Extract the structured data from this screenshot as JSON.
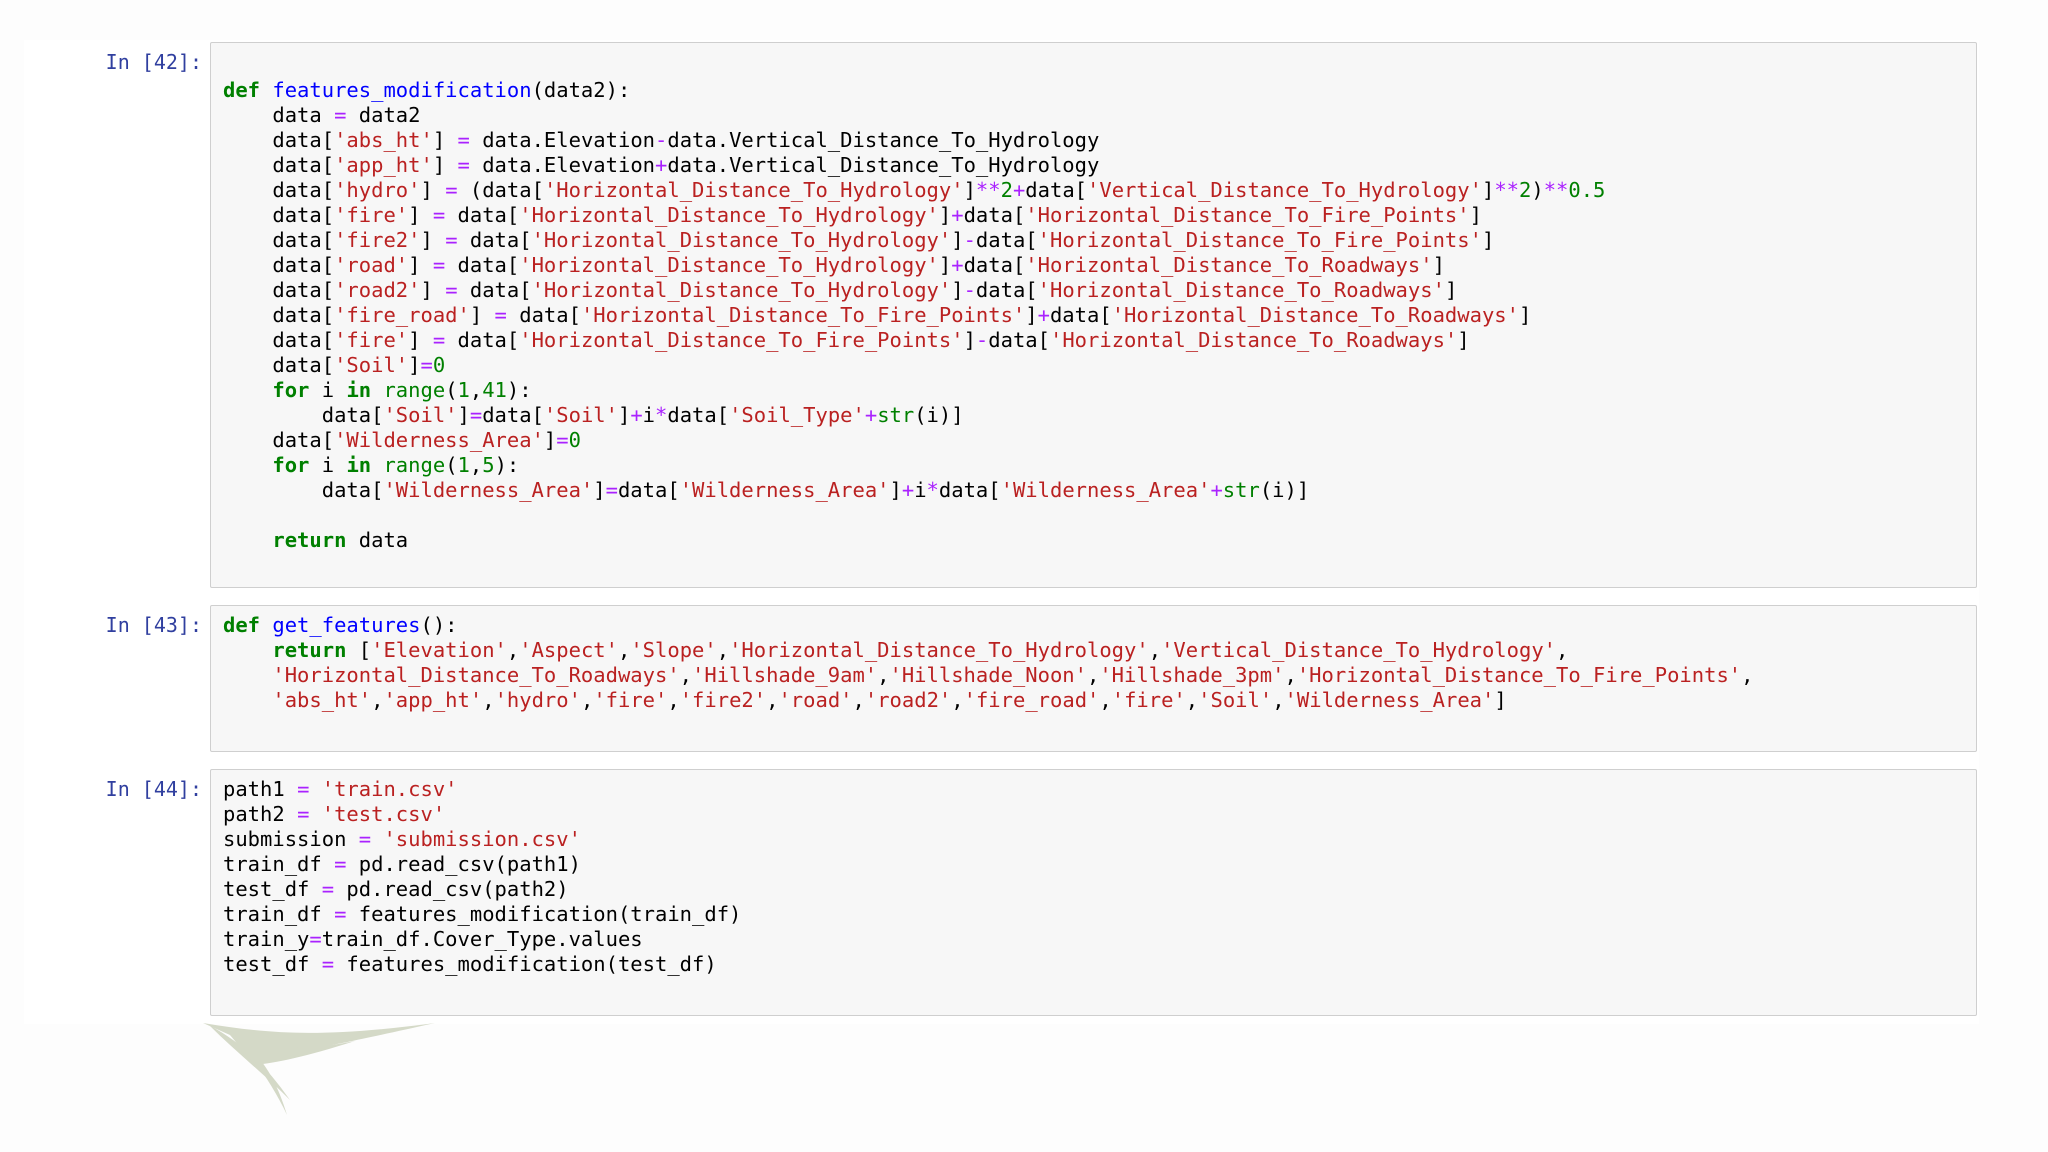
{
  "cells": [
    {
      "prompt": "In [42]:",
      "lines": [
        [
          [
            "kw",
            "def"
          ],
          [
            "p",
            " "
          ],
          [
            "fn",
            "features_modification"
          ],
          [
            "p",
            "(data2):"
          ]
        ],
        [
          [
            "p",
            "    data "
          ],
          [
            "op",
            "="
          ],
          [
            "p",
            " data2"
          ]
        ],
        [
          [
            "p",
            "    data["
          ],
          [
            "str",
            "'abs_ht'"
          ],
          [
            "p",
            "] "
          ],
          [
            "op",
            "="
          ],
          [
            "p",
            " data.Elevation"
          ],
          [
            "op",
            "-"
          ],
          [
            "p",
            "data.Vertical_Distance_To_Hydrology"
          ]
        ],
        [
          [
            "p",
            "    data["
          ],
          [
            "str",
            "'app_ht'"
          ],
          [
            "p",
            "] "
          ],
          [
            "op",
            "="
          ],
          [
            "p",
            " data.Elevation"
          ],
          [
            "op",
            "+"
          ],
          [
            "p",
            "data.Vertical_Distance_To_Hydrology"
          ]
        ],
        [
          [
            "p",
            "    data["
          ],
          [
            "str",
            "'hydro'"
          ],
          [
            "p",
            "] "
          ],
          [
            "op",
            "="
          ],
          [
            "p",
            " (data["
          ],
          [
            "str",
            "'Horizontal_Distance_To_Hydrology'"
          ],
          [
            "p",
            "]"
          ],
          [
            "op",
            "**"
          ],
          [
            "num",
            "2"
          ],
          [
            "op",
            "+"
          ],
          [
            "p",
            "data["
          ],
          [
            "str",
            "'Vertical_Distance_To_Hydrology'"
          ],
          [
            "p",
            "]"
          ],
          [
            "op",
            "**"
          ],
          [
            "num",
            "2"
          ],
          [
            "p",
            ")"
          ],
          [
            "op",
            "**"
          ],
          [
            "num",
            "0.5"
          ]
        ],
        [
          [
            "p",
            "    data["
          ],
          [
            "str",
            "'fire'"
          ],
          [
            "p",
            "] "
          ],
          [
            "op",
            "="
          ],
          [
            "p",
            " data["
          ],
          [
            "str",
            "'Horizontal_Distance_To_Hydrology'"
          ],
          [
            "p",
            "]"
          ],
          [
            "op",
            "+"
          ],
          [
            "p",
            "data["
          ],
          [
            "str",
            "'Horizontal_Distance_To_Fire_Points'"
          ],
          [
            "p",
            "]"
          ]
        ],
        [
          [
            "p",
            "    data["
          ],
          [
            "str",
            "'fire2'"
          ],
          [
            "p",
            "] "
          ],
          [
            "op",
            "="
          ],
          [
            "p",
            " data["
          ],
          [
            "str",
            "'Horizontal_Distance_To_Hydrology'"
          ],
          [
            "p",
            "]"
          ],
          [
            "op",
            "-"
          ],
          [
            "p",
            "data["
          ],
          [
            "str",
            "'Horizontal_Distance_To_Fire_Points'"
          ],
          [
            "p",
            "]"
          ]
        ],
        [
          [
            "p",
            "    data["
          ],
          [
            "str",
            "'road'"
          ],
          [
            "p",
            "] "
          ],
          [
            "op",
            "="
          ],
          [
            "p",
            " data["
          ],
          [
            "str",
            "'Horizontal_Distance_To_Hydrology'"
          ],
          [
            "p",
            "]"
          ],
          [
            "op",
            "+"
          ],
          [
            "p",
            "data["
          ],
          [
            "str",
            "'Horizontal_Distance_To_Roadways'"
          ],
          [
            "p",
            "]"
          ]
        ],
        [
          [
            "p",
            "    data["
          ],
          [
            "str",
            "'road2'"
          ],
          [
            "p",
            "] "
          ],
          [
            "op",
            "="
          ],
          [
            "p",
            " data["
          ],
          [
            "str",
            "'Horizontal_Distance_To_Hydrology'"
          ],
          [
            "p",
            "]"
          ],
          [
            "op",
            "-"
          ],
          [
            "p",
            "data["
          ],
          [
            "str",
            "'Horizontal_Distance_To_Roadways'"
          ],
          [
            "p",
            "]"
          ]
        ],
        [
          [
            "p",
            "    data["
          ],
          [
            "str",
            "'fire_road'"
          ],
          [
            "p",
            "] "
          ],
          [
            "op",
            "="
          ],
          [
            "p",
            " data["
          ],
          [
            "str",
            "'Horizontal_Distance_To_Fire_Points'"
          ],
          [
            "p",
            "]"
          ],
          [
            "op",
            "+"
          ],
          [
            "p",
            "data["
          ],
          [
            "str",
            "'Horizontal_Distance_To_Roadways'"
          ],
          [
            "p",
            "]"
          ]
        ],
        [
          [
            "p",
            "    data["
          ],
          [
            "str",
            "'fire'"
          ],
          [
            "p",
            "] "
          ],
          [
            "op",
            "="
          ],
          [
            "p",
            " data["
          ],
          [
            "str",
            "'Horizontal_Distance_To_Fire_Points'"
          ],
          [
            "p",
            "]"
          ],
          [
            "op",
            "-"
          ],
          [
            "p",
            "data["
          ],
          [
            "str",
            "'Horizontal_Distance_To_Roadways'"
          ],
          [
            "p",
            "]"
          ]
        ],
        [
          [
            "p",
            "    data["
          ],
          [
            "str",
            "'Soil'"
          ],
          [
            "p",
            "]"
          ],
          [
            "op",
            "="
          ],
          [
            "num",
            "0"
          ]
        ],
        [
          [
            "p",
            "    "
          ],
          [
            "kw",
            "for"
          ],
          [
            "p",
            " i "
          ],
          [
            "kw",
            "in"
          ],
          [
            "p",
            " "
          ],
          [
            "bi",
            "range"
          ],
          [
            "p",
            "("
          ],
          [
            "num",
            "1"
          ],
          [
            "p",
            ","
          ],
          [
            "num",
            "41"
          ],
          [
            "p",
            "):"
          ]
        ],
        [
          [
            "p",
            "        data["
          ],
          [
            "str",
            "'Soil'"
          ],
          [
            "p",
            "]"
          ],
          [
            "op",
            "="
          ],
          [
            "p",
            "data["
          ],
          [
            "str",
            "'Soil'"
          ],
          [
            "p",
            "]"
          ],
          [
            "op",
            "+"
          ],
          [
            "p",
            "i"
          ],
          [
            "op",
            "*"
          ],
          [
            "p",
            "data["
          ],
          [
            "str",
            "'Soil_Type'"
          ],
          [
            "op",
            "+"
          ],
          [
            "bi",
            "str"
          ],
          [
            "p",
            "(i)]"
          ]
        ],
        [
          [
            "p",
            "    data["
          ],
          [
            "str",
            "'Wilderness_Area'"
          ],
          [
            "p",
            "]"
          ],
          [
            "op",
            "="
          ],
          [
            "num",
            "0"
          ]
        ],
        [
          [
            "p",
            "    "
          ],
          [
            "kw",
            "for"
          ],
          [
            "p",
            " i "
          ],
          [
            "kw",
            "in"
          ],
          [
            "p",
            " "
          ],
          [
            "bi",
            "range"
          ],
          [
            "p",
            "("
          ],
          [
            "num",
            "1"
          ],
          [
            "p",
            ","
          ],
          [
            "num",
            "5"
          ],
          [
            "p",
            "):"
          ]
        ],
        [
          [
            "p",
            "        data["
          ],
          [
            "str",
            "'Wilderness_Area'"
          ],
          [
            "p",
            "]"
          ],
          [
            "op",
            "="
          ],
          [
            "p",
            "data["
          ],
          [
            "str",
            "'Wilderness_Area'"
          ],
          [
            "p",
            "]"
          ],
          [
            "op",
            "+"
          ],
          [
            "p",
            "i"
          ],
          [
            "op",
            "*"
          ],
          [
            "p",
            "data["
          ],
          [
            "str",
            "'Wilderness_Area'"
          ],
          [
            "op",
            "+"
          ],
          [
            "bi",
            "str"
          ],
          [
            "p",
            "(i)]"
          ]
        ],
        [
          [
            "p",
            ""
          ]
        ],
        [
          [
            "p",
            "    "
          ],
          [
            "kw",
            "return"
          ],
          [
            "p",
            " data"
          ]
        ]
      ]
    },
    {
      "prompt": "In [43]:",
      "lines": [
        [
          [
            "kw",
            "def"
          ],
          [
            "p",
            " "
          ],
          [
            "fn",
            "get_features"
          ],
          [
            "p",
            "():"
          ]
        ],
        [
          [
            "p",
            "    "
          ],
          [
            "kw",
            "return"
          ],
          [
            "p",
            " ["
          ],
          [
            "str",
            "'Elevation'"
          ],
          [
            "p",
            ","
          ],
          [
            "str",
            "'Aspect'"
          ],
          [
            "p",
            ","
          ],
          [
            "str",
            "'Slope'"
          ],
          [
            "p",
            ","
          ],
          [
            "str",
            "'Horizontal_Distance_To_Hydrology'"
          ],
          [
            "p",
            ","
          ],
          [
            "str",
            "'Vertical_Distance_To_Hydrology'"
          ],
          [
            "p",
            ","
          ]
        ],
        [
          [
            "p",
            "    "
          ],
          [
            "str",
            "'Horizontal_Distance_To_Roadways'"
          ],
          [
            "p",
            ","
          ],
          [
            "str",
            "'Hillshade_9am'"
          ],
          [
            "p",
            ","
          ],
          [
            "str",
            "'Hillshade_Noon'"
          ],
          [
            "p",
            ","
          ],
          [
            "str",
            "'Hillshade_3pm'"
          ],
          [
            "p",
            ","
          ],
          [
            "str",
            "'Horizontal_Distance_To_Fire_Points'"
          ],
          [
            "p",
            ","
          ]
        ],
        [
          [
            "p",
            "    "
          ],
          [
            "str",
            "'abs_ht'"
          ],
          [
            "p",
            ","
          ],
          [
            "str",
            "'app_ht'"
          ],
          [
            "p",
            ","
          ],
          [
            "str",
            "'hydro'"
          ],
          [
            "p",
            ","
          ],
          [
            "str",
            "'fire'"
          ],
          [
            "p",
            ","
          ],
          [
            "str",
            "'fire2'"
          ],
          [
            "p",
            ","
          ],
          [
            "str",
            "'road'"
          ],
          [
            "p",
            ","
          ],
          [
            "str",
            "'road2'"
          ],
          [
            "p",
            ","
          ],
          [
            "str",
            "'fire_road'"
          ],
          [
            "p",
            ","
          ],
          [
            "str",
            "'fire'"
          ],
          [
            "p",
            ","
          ],
          [
            "str",
            "'Soil'"
          ],
          [
            "p",
            ","
          ],
          [
            "str",
            "'Wilderness_Area'"
          ],
          [
            "p",
            "]"
          ]
        ]
      ]
    },
    {
      "prompt": "In [44]:",
      "lines": [
        [
          [
            "p",
            "path1 "
          ],
          [
            "op",
            "="
          ],
          [
            "p",
            " "
          ],
          [
            "str",
            "'train.csv'"
          ]
        ],
        [
          [
            "p",
            "path2 "
          ],
          [
            "op",
            "="
          ],
          [
            "p",
            " "
          ],
          [
            "str",
            "'test.csv'"
          ]
        ],
        [
          [
            "p",
            "submission "
          ],
          [
            "op",
            "="
          ],
          [
            "p",
            " "
          ],
          [
            "str",
            "'submission.csv'"
          ]
        ],
        [
          [
            "p",
            "train_df "
          ],
          [
            "op",
            "="
          ],
          [
            "p",
            " pd.read_csv(path1)"
          ]
        ],
        [
          [
            "p",
            "test_df "
          ],
          [
            "op",
            "="
          ],
          [
            "p",
            " pd.read_csv(path2)"
          ]
        ],
        [
          [
            "p",
            "train_df "
          ],
          [
            "op",
            "="
          ],
          [
            "p",
            " features_modification(train_df)"
          ]
        ],
        [
          [
            "p",
            "train_y"
          ],
          [
            "op",
            "="
          ],
          [
            "p",
            "train_df.Cover_Type.values"
          ]
        ],
        [
          [
            "p",
            "test_df "
          ],
          [
            "op",
            "="
          ],
          [
            "p",
            " features_modification(test_df)"
          ]
        ]
      ]
    }
  ]
}
